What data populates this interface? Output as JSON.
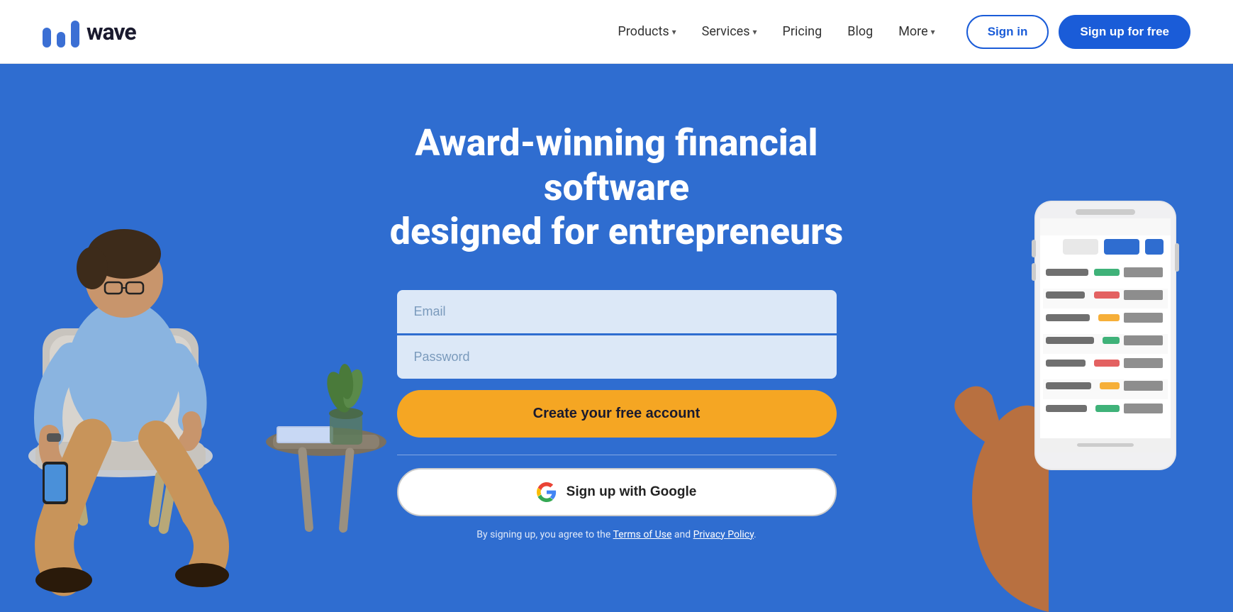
{
  "navbar": {
    "logo_text": "wave",
    "nav_items": [
      {
        "label": "Products",
        "has_dropdown": true
      },
      {
        "label": "Services",
        "has_dropdown": true
      },
      {
        "label": "Pricing",
        "has_dropdown": false
      },
      {
        "label": "Blog",
        "has_dropdown": false
      },
      {
        "label": "More",
        "has_dropdown": true
      }
    ],
    "signin_label": "Sign in",
    "signup_label": "Sign up for free"
  },
  "hero": {
    "headline_line1": "Award-winning financial software",
    "headline_line2": "designed for entrepreneurs",
    "email_placeholder": "Email",
    "password_placeholder": "Password",
    "create_account_label": "Create your free account",
    "google_signup_label": "Sign up with Google",
    "terms_prefix": "By signing up, you agree to the ",
    "terms_link": "Terms of Use",
    "terms_middle": " and ",
    "privacy_link": "Privacy Policy",
    "terms_suffix": "."
  },
  "colors": {
    "hero_bg": "#2f6dd0",
    "btn_yellow": "#f5a623",
    "btn_blue": "#1a5cd8",
    "input_bg": "#dce8f7"
  }
}
